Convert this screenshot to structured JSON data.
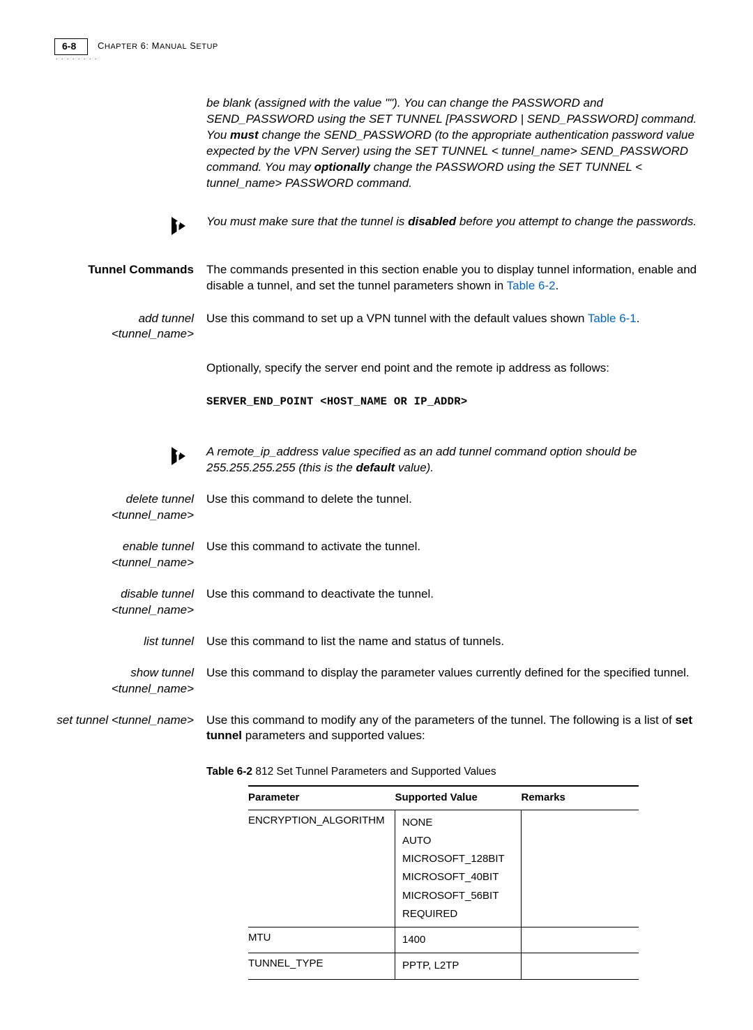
{
  "header": {
    "page_number": "6-8",
    "chapter_label": "Chapter 6: Manual Setup"
  },
  "intro_note_italic": {
    "p1a": "be blank (assigned with the value \"\"). You can change the PASSWORD and SEND_PASSWORD using the SET TUNNEL [PASSWORD | SEND_PASSWORD] command. You ",
    "must": "must",
    "p1b": " change the SEND_PASSWORD (to the appropriate authentication password value expected by the VPN Server) using the SET TUNNEL < tunnel_name> SEND_PASSWORD command.   You may ",
    "optionally": "optionally",
    "p1c": " change the PASSWORD using the SET TUNNEL < tunnel_name> PASSWORD command."
  },
  "note_disabled": {
    "a": "You must make sure that the tunnel is ",
    "disabled": "disabled",
    "b": " before you attempt to change the passwords."
  },
  "tunnel_commands": {
    "label": "Tunnel Commands",
    "text_a": "The commands presented in this section enable you to display tunnel information, enable and disable a tunnel, and set the tunnel parameters shown in ",
    "link": "Table 6-2",
    "text_b": "."
  },
  "add_tunnel": {
    "label": "add tunnel <tunnel_name>",
    "text_a": "Use this command to set up a VPN tunnel with the default values shown ",
    "link": "Table 6-1",
    "text_b": ".",
    "optional_line": "Optionally, specify the server end point and the remote ip address as follows:",
    "code": "SERVER_END_POINT <HOST_NAME OR IP_ADDR>"
  },
  "note_remote_ip": {
    "a": "A remote_ip_address value specified as an add tunnel command option should be 255.255.255.255 (this is the ",
    "default": "default",
    "b": " value)."
  },
  "delete_tunnel": {
    "label1": "delete tunnel",
    "label2": "<tunnel_name>",
    "text": "Use this command to delete the tunnel."
  },
  "enable_tunnel": {
    "label1": "enable tunnel",
    "label2": "<tunnel_name>",
    "text": "Use this command to activate the tunnel."
  },
  "disable_tunnel": {
    "label1": "disable tunnel",
    "label2": "<tunnel_name>",
    "text": "Use this command to deactivate the tunnel."
  },
  "list_tunnel": {
    "label": "list tunnel",
    "text": "Use this command to list the name and status of tunnels."
  },
  "show_tunnel": {
    "label1": "show tunnel",
    "label2": "<tunnel_name>",
    "text": "Use this command to display the parameter values currently defined for the specified tunnel."
  },
  "set_tunnel": {
    "label": "set tunnel <tunnel_name>",
    "text_a": "Use this command to modify any of the parameters of the tunnel. The following is a list of ",
    "bold": "set tunnel",
    "text_b": " parameters and supported values:"
  },
  "table": {
    "caption_bold": "Table 6-2",
    "caption_rest": "   812 Set Tunnel Parameters and Supported Values",
    "headers": {
      "param": "Parameter",
      "supp": "Supported Value",
      "rem": "Remarks"
    },
    "rows": [
      {
        "param": "ENCRYPTION_ALGORITHM",
        "supp": [
          "NONE",
          "AUTO",
          "MICROSOFT_128BIT",
          "MICROSOFT_40BIT",
          "MICROSOFT_56BIT",
          "REQUIRED"
        ],
        "rem": ""
      },
      {
        "param": "MTU",
        "supp": [
          "1400"
        ],
        "rem": ""
      },
      {
        "param": "TUNNEL_TYPE",
        "supp": [
          "PPTP, L2TP"
        ],
        "rem": ""
      }
    ]
  }
}
